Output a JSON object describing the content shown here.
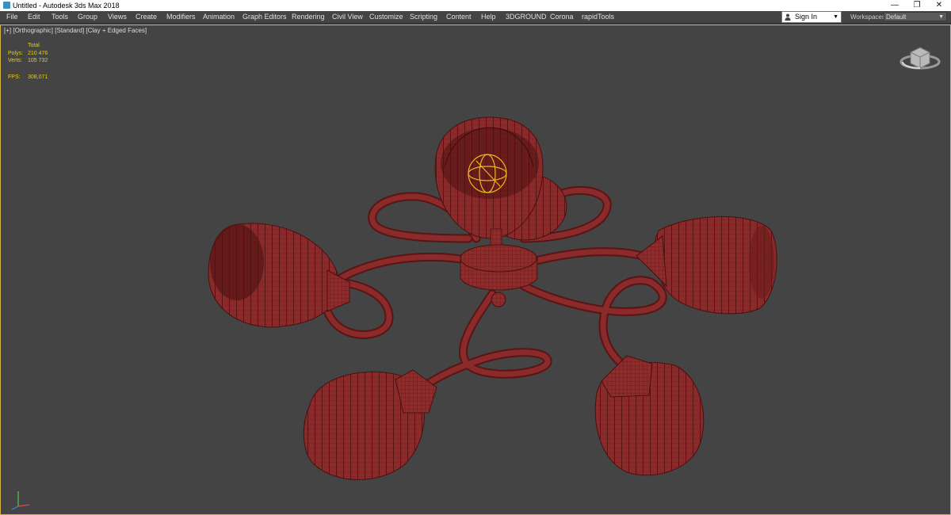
{
  "window": {
    "title": "Untitled - Autodesk 3ds Max 2018",
    "controls": [
      "—",
      "❐",
      "✕"
    ]
  },
  "menu": {
    "items": [
      "File",
      "Edit",
      "Tools",
      "Group",
      "Views",
      "Create",
      "Modifiers",
      "Animation",
      "Graph Editors",
      "Rendering",
      "Civil View",
      "Customize",
      "Scripting",
      "Content",
      "Help",
      "3DGROUND",
      "Corona",
      "rapidTools"
    ]
  },
  "account": {
    "sign_in_label": "Sign In",
    "icon": "user-icon"
  },
  "workspaces": {
    "label": "Workspaces:",
    "selected": "Default"
  },
  "viewport": {
    "label": "[+] [Orthographic] [Standard] [Clay + Edged Faces]",
    "border_color": "#d6b341",
    "background": "#444444",
    "mesh_color": "#8a2a2a",
    "selection_color": "#e8b820",
    "stats": {
      "total_label": "Total",
      "polys_label": "Polys:",
      "polys_value": "210 476",
      "verts_label": "Verts:",
      "verts_value": "105 732",
      "fps_label": "FPS:",
      "fps_value": "308,071"
    }
  }
}
